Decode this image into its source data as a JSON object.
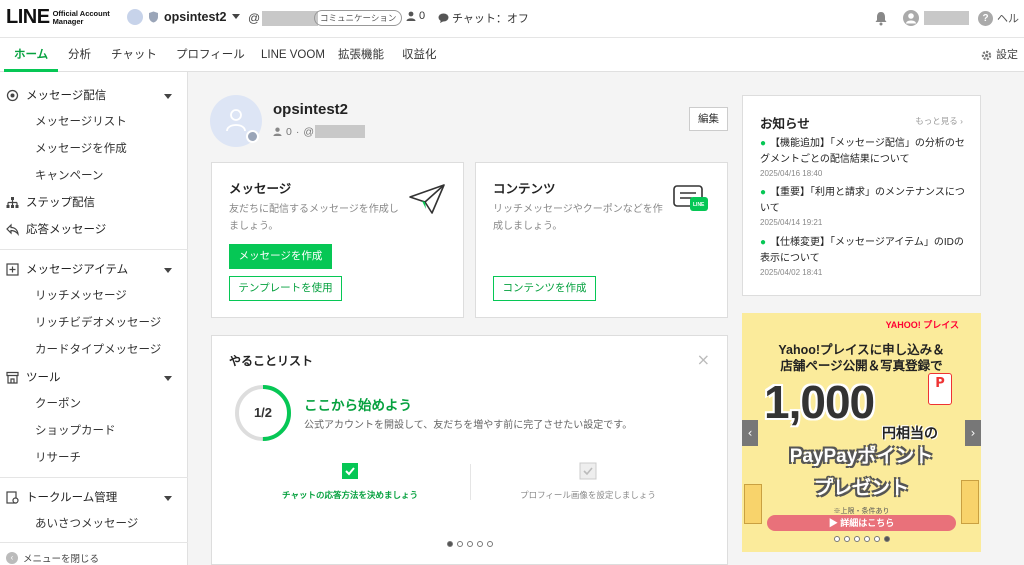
{
  "header": {
    "logo": "LINE",
    "logo_sub_1": "Official Account",
    "logo_sub_2": "Manager",
    "account_name": "opsintest2",
    "at_prefix": "@",
    "community_badge": "コミュニケーション",
    "friend_count": "0",
    "chat_status": "チャット：オフ",
    "help_label": "ヘル"
  },
  "tabs": {
    "home": "ホーム",
    "analytics": "分析",
    "chat": "チャット",
    "profile": "プロフィール",
    "voom": "LINE VOOM",
    "extensions": "拡張機能",
    "monetize": "収益化",
    "settings": "設定"
  },
  "sidebar": {
    "msg_delivery": "メッセージ配信",
    "msg_list": "メッセージリスト",
    "msg_create": "メッセージを作成",
    "campaign": "キャンペーン",
    "step": "ステップ配信",
    "auto_reply": "応答メッセージ",
    "msg_items": "メッセージアイテム",
    "rich_msg": "リッチメッセージ",
    "rich_video": "リッチビデオメッセージ",
    "card_type": "カードタイプメッセージ",
    "tools": "ツール",
    "coupon": "クーポン",
    "shop_card": "ショップカード",
    "research": "リサーチ",
    "talk_room": "トークルーム管理",
    "greeting": "あいさつメッセージ",
    "collapse": "メニューを閉じる"
  },
  "profile": {
    "name": "opsintest2",
    "friends": "0",
    "separator": "·",
    "at_prefix": "@",
    "edit_label": "編集"
  },
  "message_card": {
    "title": "メッセージ",
    "desc": "友だちに配信するメッセージを作成しましょう。",
    "primary_btn": "メッセージを作成",
    "secondary_btn": "テンプレートを使用"
  },
  "content_card": {
    "title": "コンテンツ",
    "desc": "リッチメッセージやクーポンなどを作成しましょう。",
    "btn": "コンテンツを作成",
    "icon_text": "LINE"
  },
  "todo": {
    "title": "やることリスト",
    "progress_label": "1/2",
    "progress_fraction": 0.5,
    "heading": "ここから始めよう",
    "sub": "公式アカウントを開設して、友だちを増やす前に完了させたい設定です。",
    "step1": "チャットの応答方法を決めましょう",
    "step2": "プロフィール画像を設定しましょう",
    "close_icon": "×"
  },
  "news": {
    "title": "お知らせ",
    "more": "もっと見る",
    "items": [
      {
        "text": "【機能追加】「メッセージ配信」の分析のセグメントごとの配信結果について",
        "date": "2025/04/16 18:40"
      },
      {
        "text": "【重要】「利用と請求」のメンテナンスについて",
        "date": "2025/04/14 19:21"
      },
      {
        "text": "【仕様変更】「メッセージアイテム」のIDの表示について",
        "date": "2025/04/02 18:41"
      }
    ]
  },
  "ad": {
    "brand": "YAHOO! プレイス",
    "line1": "Yahoo!プレイスに申し込み＆",
    "line2": "店舗ページ公開＆写真登録で",
    "amount": "1,000",
    "point_badge": "P",
    "yen_label": "円相当の",
    "paypay": "PayPayポイント",
    "present": "プレゼント",
    "cond": "※上限・条件あり",
    "detail_btn": "▶ 詳細はこちら"
  },
  "colors": {
    "accent": "#06c755",
    "accent_dark": "#06a13f"
  }
}
